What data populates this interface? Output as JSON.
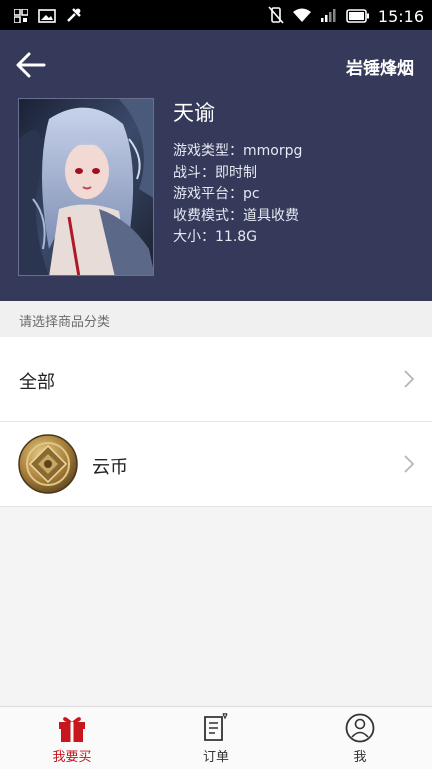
{
  "status_bar": {
    "time": "15:16"
  },
  "header": {
    "account_name": "岩锤烽烟",
    "game": {
      "title": "天谕",
      "info": [
        "游戏类型：mmorpg",
        "战斗：即时制",
        "游戏平台：pc",
        "收费模式：道具收费",
        "大小：11.8G"
      ]
    }
  },
  "section": {
    "label": "请选择商品分类"
  },
  "categories": [
    {
      "label": "全部",
      "icon": null
    },
    {
      "label": "云币",
      "icon": "gold-coin-icon"
    }
  ],
  "bottom_nav": {
    "items": [
      {
        "label": "我要买",
        "icon": "gift-icon",
        "active": true
      },
      {
        "label": "订单",
        "icon": "order-list-icon",
        "active": false
      },
      {
        "label": "我",
        "icon": "user-profile-icon",
        "active": false
      }
    ]
  },
  "colors": {
    "header_bg": "#353a5a",
    "accent": "#c8161d",
    "page_bg": "#f4f4f4"
  }
}
